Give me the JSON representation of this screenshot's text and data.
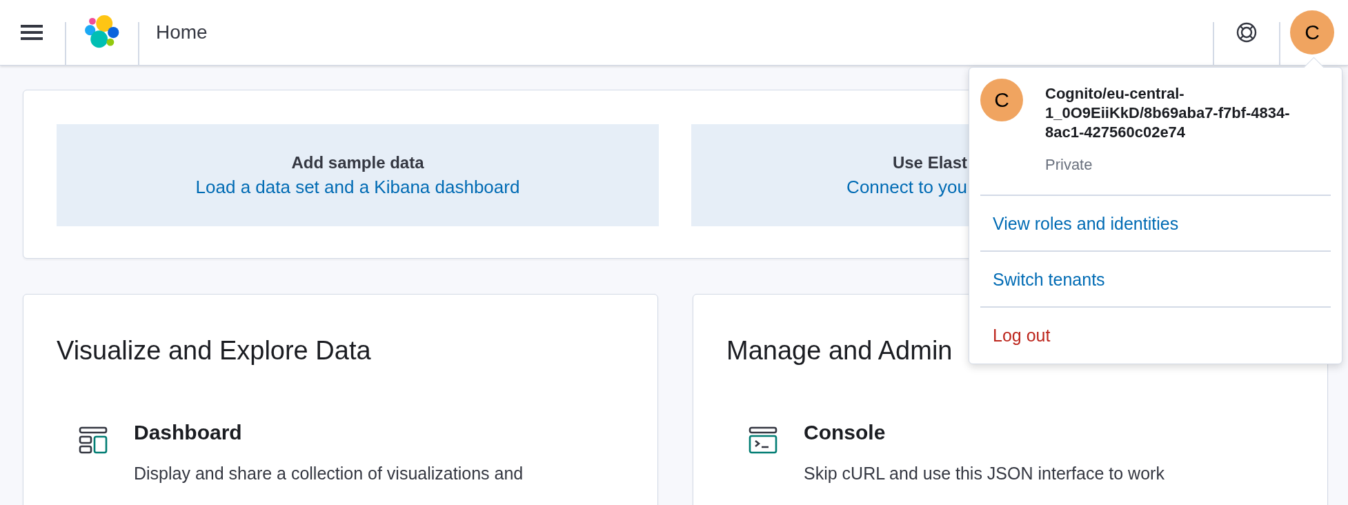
{
  "header": {
    "breadcrumb": "Home",
    "avatar": "C"
  },
  "user_menu": {
    "avatar": "C",
    "name": "Cognito/eu-central-1_0O9EiiKkD/8b69aba7-f7bf-4834-8ac1-427560c02e74",
    "tenant": "Private",
    "items": [
      {
        "label": "View roles and identities",
        "kind": "link"
      },
      {
        "label": "Switch tenants",
        "kind": "link"
      },
      {
        "label": "Log out",
        "kind": "danger"
      }
    ]
  },
  "add_data": [
    {
      "title": "Add sample data",
      "link": "Load a data set and a Kibana dashboard"
    },
    {
      "title": "Use Elast",
      "link": "Connect to you"
    }
  ],
  "sections": [
    {
      "title": "Visualize and Explore Data",
      "apps": [
        {
          "kind": "dashboard",
          "name": "Dashboard",
          "description": "Display and share a collection of visualizations and"
        }
      ]
    },
    {
      "title": "Manage and Admin",
      "apps": [
        {
          "kind": "console",
          "name": "Console",
          "description": "Skip cURL and use this JSON interface to work"
        }
      ]
    }
  ]
}
